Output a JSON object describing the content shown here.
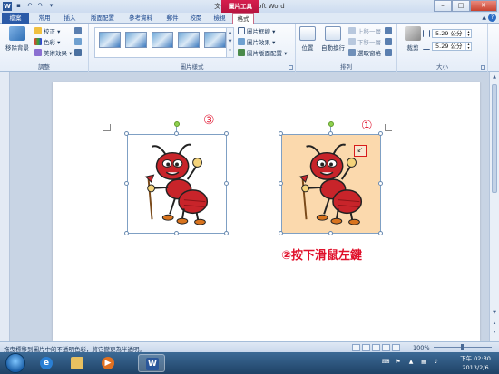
{
  "window": {
    "title": "文件1 - Microsoft Word",
    "context_tab": "圖片工具",
    "app_icon_letter": "W",
    "controls": {
      "minimize": "–",
      "maximize": "□",
      "close": "✕"
    }
  },
  "tabs": [
    {
      "label": "檔案"
    },
    {
      "label": "常用"
    },
    {
      "label": "插入"
    },
    {
      "label": "版面配置"
    },
    {
      "label": "參考資料"
    },
    {
      "label": "郵件"
    },
    {
      "label": "校閱"
    },
    {
      "label": "檢視"
    },
    {
      "label": "格式"
    }
  ],
  "ribbon": {
    "adjust": {
      "label": "調整",
      "remove_bg": "移除背景",
      "corrections": "校正",
      "color": "色彩",
      "artistic": "美術效果"
    },
    "styles": {
      "label": "圖片樣式",
      "border": "圖片框線",
      "effects": "圖片效果",
      "layout": "圖片版面配置"
    },
    "arrange": {
      "label": "排列",
      "position": "位置",
      "wrap": "自動換行",
      "bring_forward": "上移一層",
      "send_backward": "下移一層",
      "selection_pane": "選取窗格"
    },
    "size": {
      "label": "大小",
      "crop": "裁剪",
      "height": "5.29 公分",
      "width": "5.29 公分"
    }
  },
  "document": {
    "marker_left": "③",
    "marker_right": "①",
    "instruction": "②按下滑鼠左鍵"
  },
  "status": {
    "text": "拖曳標移到圖片中的不透明色彩，將它變更為半透明。",
    "zoom": "100%"
  },
  "taskbar": {
    "word_letter": "W",
    "time": "下午 02:30",
    "date": "2013/2/6"
  }
}
